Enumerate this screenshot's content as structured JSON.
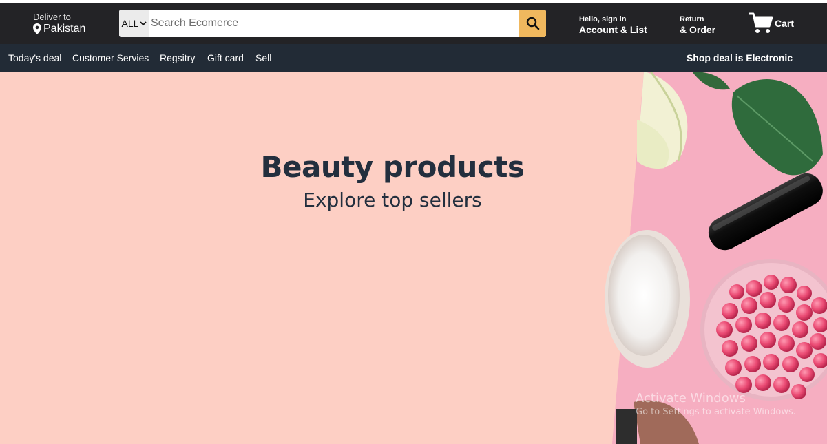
{
  "header": {
    "deliver": {
      "line1": "Deliver to",
      "line2": "Pakistan"
    },
    "search": {
      "category": "ALL",
      "placeholder": "Search Ecomerce"
    },
    "account": {
      "line1": "Hello, sign in",
      "line2": "Account & List"
    },
    "returns": {
      "line1": "Return",
      "line2": "& Order"
    },
    "cart": {
      "label": "Cart"
    }
  },
  "nav": {
    "items": [
      {
        "label": "Today's deal"
      },
      {
        "label": "Customer Servies"
      },
      {
        "label": "Regsitry"
      },
      {
        "label": "Gift card"
      },
      {
        "label": "Sell"
      }
    ],
    "promo": "Shop deal is Electronic"
  },
  "hero": {
    "title": "Beauty products",
    "subtitle": "Explore top sellers"
  },
  "watermark": {
    "line1": "Activate Windows",
    "line2": "Go to Settings to activate Windows."
  },
  "colors": {
    "header_bg": "#232326",
    "nav_bg": "#222b36",
    "search_button": "#f0b85e",
    "hero_bg": "#fdcfc4",
    "hero_text": "#232f3e"
  },
  "icons": {
    "location": "location-pin-icon",
    "dropdown": "chevron-down-icon",
    "search": "search-icon",
    "cart": "cart-icon"
  }
}
